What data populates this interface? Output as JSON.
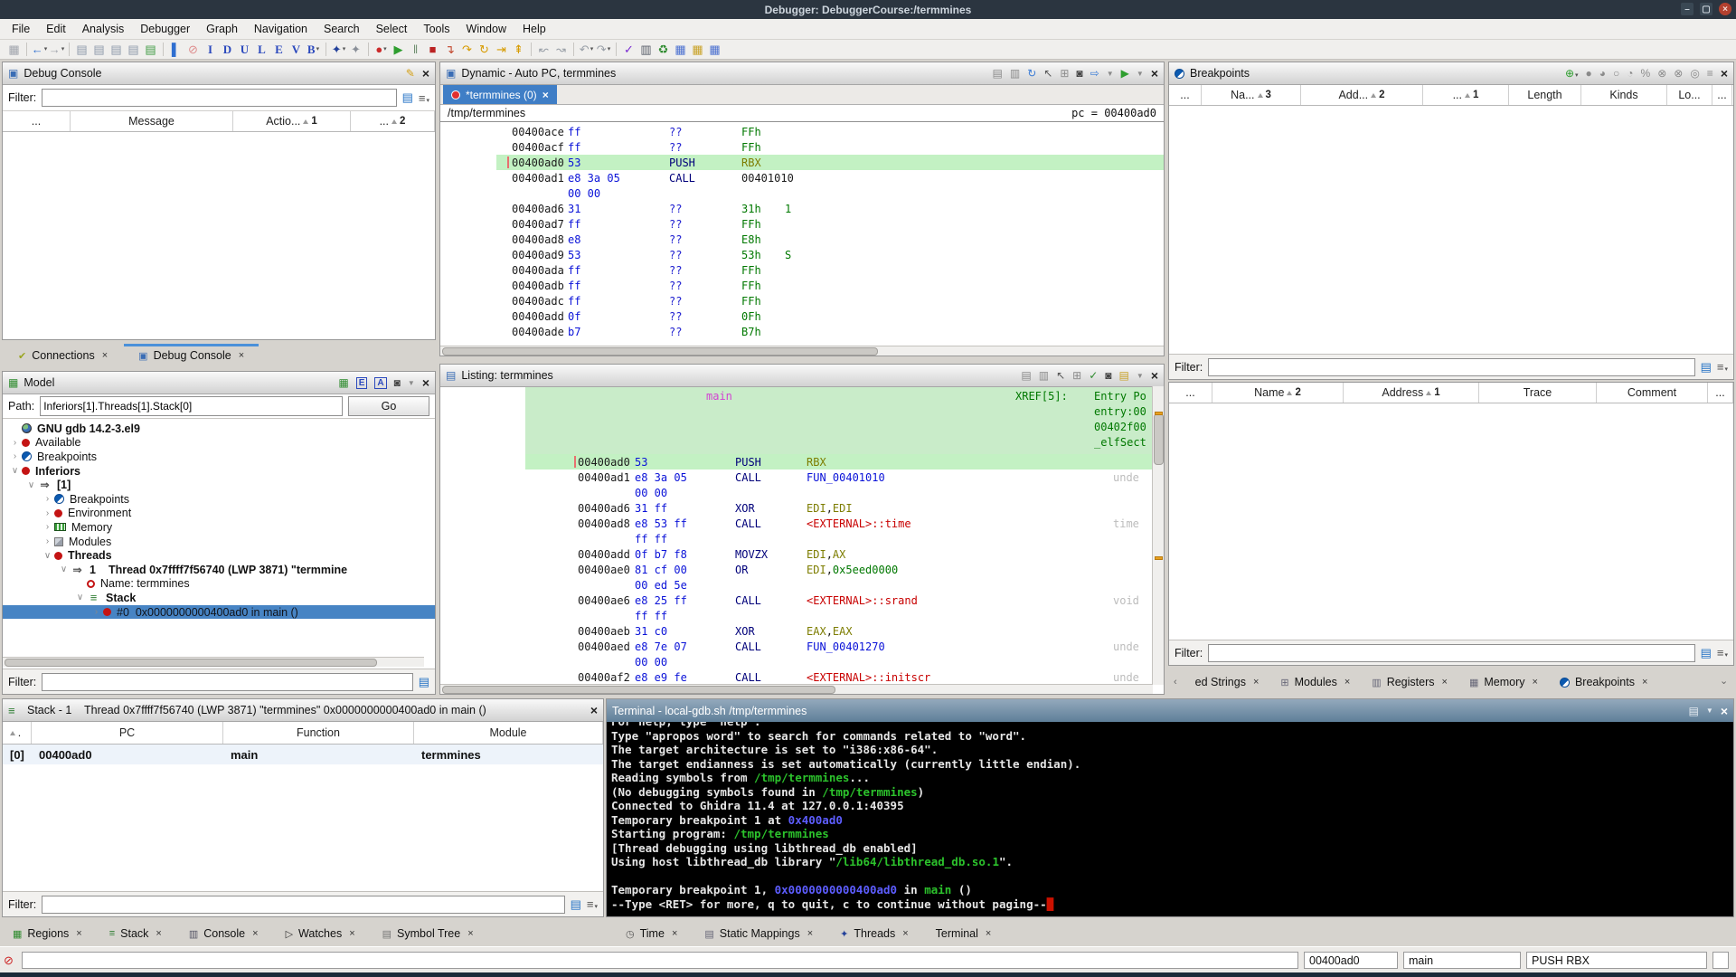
{
  "colors": {
    "accent_blue": "#3f7ec6",
    "pc_highlight_green": "#c3f1c3",
    "function_block_green": "#c9ecc9",
    "terminal_green": "#2cc22c",
    "terminal_blue": "#5d5dff",
    "terminal_cursor_red": "#cc1100",
    "titlebar_dark": "#2b3540"
  },
  "titlebar": {
    "title": "Debugger: DebuggerCourse:/termmines"
  },
  "menu": {
    "items": [
      "File",
      "Edit",
      "Analysis",
      "Debugger",
      "Graph",
      "Navigation",
      "Search",
      "Select",
      "Tools",
      "Window",
      "Help"
    ]
  },
  "toolbar": {
    "icons": [
      {
        "name": "save",
        "g": "▦",
        "c": "#a0a4ac"
      },
      {
        "sep": true
      },
      {
        "name": "nav-back",
        "g": "←",
        "c": "#2f6fd0",
        "v": true
      },
      {
        "name": "nav-forward",
        "g": "→",
        "c": "#a0a4ac",
        "v": true
      },
      {
        "sep": true
      },
      {
        "name": "copy-1",
        "g": "▤",
        "c": "#8d99aa"
      },
      {
        "name": "copy-2",
        "g": "▤",
        "c": "#8d99aa"
      },
      {
        "name": "copy-3",
        "g": "▤",
        "c": "#8d99aa"
      },
      {
        "name": "copy-4",
        "g": "▤",
        "c": "#8d99aa"
      },
      {
        "name": "copy-green",
        "g": "▤",
        "c": "#3f9b43"
      },
      {
        "sep": true
      },
      {
        "name": "cursor",
        "g": "▌",
        "c": "#2f6fd0"
      },
      {
        "name": "clear-highlight",
        "g": "⊘",
        "c": "#de8c8c"
      },
      {
        "name": "select-i",
        "g": "I",
        "c": "#2b49bd",
        "serif": true
      },
      {
        "name": "select-d",
        "g": "D",
        "c": "#2b49bd",
        "serif": true
      },
      {
        "name": "select-u",
        "g": "U",
        "c": "#2b49bd",
        "serif": true
      },
      {
        "name": "select-l",
        "g": "L",
        "c": "#2b49bd",
        "serif": true
      },
      {
        "name": "select-e",
        "g": "E",
        "c": "#2b49bd",
        "serif": true
      },
      {
        "name": "select-v",
        "g": "V",
        "c": "#2b49bd",
        "serif": true
      },
      {
        "name": "select-b",
        "g": "B",
        "c": "#2b49bd",
        "serif": true,
        "v": true
      },
      {
        "sep": true
      },
      {
        "name": "debug-target",
        "g": "✦",
        "c": "#23409a",
        "v": true
      },
      {
        "name": "debug-target-alt",
        "g": "✦",
        "c": "#8a8f98"
      },
      {
        "sep": true
      },
      {
        "name": "record",
        "g": "●",
        "c": "#cc2b2b",
        "v": true
      },
      {
        "name": "resume",
        "g": "▶",
        "c": "#2f9e2f"
      },
      {
        "name": "interrupt",
        "g": "‖",
        "c": "#6f8f6f"
      },
      {
        "name": "kill",
        "g": "■",
        "c": "#bb2222"
      },
      {
        "name": "step-into",
        "g": "↴",
        "c": "#c2452b"
      },
      {
        "name": "step-over",
        "g": "↷",
        "c": "#d79b00"
      },
      {
        "name": "step-out",
        "g": "↻",
        "c": "#d79b00"
      },
      {
        "name": "step-last",
        "g": "⇥",
        "c": "#d79b00"
      },
      {
        "name": "step-ext",
        "g": "⇞",
        "c": "#d79b00"
      },
      {
        "sep": true
      },
      {
        "name": "skip-over",
        "g": "↜",
        "c": "#9aa0a8"
      },
      {
        "name": "skip-out",
        "g": "↝",
        "c": "#9aa0a8"
      },
      {
        "sep": true
      },
      {
        "name": "undo",
        "g": "↶",
        "c": "#9aa0a8",
        "v": true
      },
      {
        "name": "redo",
        "g": "↷",
        "c": "#9aa0a8",
        "v": true
      },
      {
        "sep": true
      },
      {
        "name": "validate",
        "g": "✓",
        "c": "#7a2bd2"
      },
      {
        "name": "binary-view",
        "g": "▥",
        "c": "#555b66"
      },
      {
        "name": "recycle",
        "g": "♻",
        "c": "#2e8b2e"
      },
      {
        "name": "table-1",
        "g": "▦",
        "c": "#4a6fd0"
      },
      {
        "name": "table-2",
        "g": "▦",
        "c": "#c9a227"
      },
      {
        "name": "table-3",
        "g": "▦",
        "c": "#4a6fd0"
      }
    ]
  },
  "debug_console": {
    "title": "Debug Console",
    "filter_label": "Filter:",
    "filter_value": "",
    "columns": [
      {
        "label": "..."
      },
      {
        "label": "Message"
      },
      {
        "label": "Actio...",
        "sort": 1
      },
      {
        "label": "...",
        "sort": 2
      }
    ]
  },
  "left_tabs": [
    {
      "label": "Connections",
      "icon": "connections"
    },
    {
      "label": "Debug Console",
      "icon": "console",
      "selected": true
    }
  ],
  "model": {
    "title": "Model",
    "path_label": "Path:",
    "path_value": "Inferiors[1].Threads[1].Stack[0]",
    "go_label": "Go",
    "filter_label": "Filter:",
    "tree": [
      {
        "d": 0,
        "i": "bug",
        "l": "GNU gdb 14.2-3.el9",
        "b": true
      },
      {
        "d": 0,
        "a": "c",
        "i": "dot",
        "l": "Available"
      },
      {
        "d": 0,
        "a": "c",
        "i": "brk",
        "l": "Breakpoints"
      },
      {
        "d": 0,
        "a": "v",
        "i": "dot",
        "l": "Inferiors",
        "b": true
      },
      {
        "d": 1,
        "a": "v",
        "i": "arr",
        "l": "[1]",
        "b": true
      },
      {
        "d": 2,
        "a": "c",
        "i": "brk",
        "l": "Breakpoints"
      },
      {
        "d": 2,
        "a": "c",
        "i": "dot",
        "l": "Environment"
      },
      {
        "d": 2,
        "a": "c",
        "i": "mem",
        "l": "Memory"
      },
      {
        "d": 2,
        "a": "c",
        "i": "mod",
        "l": "Modules"
      },
      {
        "d": 2,
        "a": "v",
        "i": "dot",
        "l": "Threads",
        "b": true
      },
      {
        "d": 3,
        "a": "v",
        "i": "arr",
        "l": "1",
        "l2": "Thread 0x7ffff7f56740 (LWP 3871) \"termmine",
        "b": true
      },
      {
        "d": 4,
        "i": "ring",
        "l": "Name: termmines"
      },
      {
        "d": 4,
        "a": "v",
        "i": "stack",
        "l": "Stack",
        "b": true
      },
      {
        "d": 5,
        "a": "c",
        "i": "dot",
        "l": "#0  0x0000000000400ad0 in main ()",
        "sel": true
      }
    ]
  },
  "dynamic": {
    "title": "Dynamic - Auto PC, termmines",
    "tab": "*termmines (0)",
    "path": "/tmp/termmines",
    "pc_label": "pc = 00400ad0",
    "rows": [
      {
        "a": "00400ace",
        "b": "ff",
        "m": "??",
        "o": "FFh",
        "oc": "g"
      },
      {
        "a": "00400acf",
        "b": "ff",
        "m": "??",
        "o": "FFh",
        "oc": "g"
      },
      {
        "a": "00400ad0",
        "b": "53",
        "m": "PUSH",
        "o": "RBX",
        "oc": "o",
        "hl": true
      },
      {
        "a": "00400ad1",
        "b": "e8 3a 05",
        "m": "CALL",
        "o": "00401010",
        "oc": "d"
      },
      {
        "cont": "00 00"
      },
      {
        "a": "00400ad6",
        "b": "31",
        "m": "??",
        "o": "31h",
        "oc": "g",
        "x": "1"
      },
      {
        "a": "00400ad7",
        "b": "ff",
        "m": "??",
        "o": "FFh",
        "oc": "g"
      },
      {
        "a": "00400ad8",
        "b": "e8",
        "m": "??",
        "o": "E8h",
        "oc": "g"
      },
      {
        "a": "00400ad9",
        "b": "53",
        "m": "??",
        "o": "53h",
        "oc": "g",
        "x": "S"
      },
      {
        "a": "00400ada",
        "b": "ff",
        "m": "??",
        "o": "FFh",
        "oc": "g"
      },
      {
        "a": "00400adb",
        "b": "ff",
        "m": "??",
        "o": "FFh",
        "oc": "g"
      },
      {
        "a": "00400adc",
        "b": "ff",
        "m": "??",
        "o": "FFh",
        "oc": "g"
      },
      {
        "a": "00400add",
        "b": "0f",
        "m": "??",
        "o": "0Fh",
        "oc": "g"
      },
      {
        "a": "00400ade",
        "b": "b7",
        "m": "??",
        "o": "B7h",
        "oc": "g"
      }
    ]
  },
  "listing": {
    "title": "Listing: termmines",
    "function_name": "main",
    "xref_label": "XREF[5]:",
    "xref_lines": [
      "Entry Po",
      "entry:00",
      "00402f00",
      "_elfSect"
    ],
    "rows": [
      {
        "a": "00400ad0",
        "b": "53",
        "m": "PUSH",
        "op": [
          [
            "RBX",
            "o"
          ]
        ],
        "hl": true
      },
      {
        "a": "00400ad1",
        "b": "e8 3a 05",
        "m": "CALL",
        "op": [
          [
            "FUN_00401010",
            "bl"
          ]
        ],
        "note": "unde"
      },
      {
        "cont": "00 00"
      },
      {
        "a": "00400ad6",
        "b": "31 ff",
        "m": "XOR",
        "op": [
          [
            "EDI",
            "o"
          ],
          [
            ",",
            "d"
          ],
          [
            "EDI",
            "o"
          ]
        ]
      },
      {
        "a": "00400ad8",
        "b": "e8 53 ff",
        "m": "CALL",
        "op": [
          [
            "<EXTERNAL>::time",
            "r"
          ]
        ],
        "note": "time"
      },
      {
        "cont": "ff ff"
      },
      {
        "a": "00400add",
        "b": "0f b7 f8",
        "m": "MOVZX",
        "op": [
          [
            "EDI",
            "o"
          ],
          [
            ",",
            "d"
          ],
          [
            "AX",
            "o"
          ]
        ]
      },
      {
        "a": "00400ae0",
        "b": "81 cf 00",
        "m": "OR",
        "op": [
          [
            "EDI",
            "o"
          ],
          [
            ",",
            "d"
          ],
          [
            "0x5eed0000",
            "g"
          ]
        ]
      },
      {
        "cont": "00 ed 5e"
      },
      {
        "a": "00400ae6",
        "b": "e8 25 ff",
        "m": "CALL",
        "op": [
          [
            "<EXTERNAL>::srand",
            "r"
          ]
        ],
        "note": "void"
      },
      {
        "cont": "ff ff"
      },
      {
        "a": "00400aeb",
        "b": "31 c0",
        "m": "XOR",
        "op": [
          [
            "EAX",
            "o"
          ],
          [
            ",",
            "d"
          ],
          [
            "EAX",
            "o"
          ]
        ]
      },
      {
        "a": "00400aed",
        "b": "e8 7e 07",
        "m": "CALL",
        "op": [
          [
            "FUN_00401270",
            "bl"
          ]
        ],
        "note": "unde"
      },
      {
        "cont": "00 00"
      },
      {
        "a": "00400af2",
        "b": "e8 e9 fe",
        "m": "CALL",
        "op": [
          [
            "<EXTERNAL>::initscr",
            "r"
          ]
        ],
        "note": "unde"
      }
    ]
  },
  "breakpoints": {
    "title": "Breakpoints",
    "filter_label": "Filter:",
    "columns": [
      {
        "label": "..."
      },
      {
        "label": "Na...",
        "sort": 3
      },
      {
        "label": "Add...",
        "sort": 2
      },
      {
        "label": "...",
        "sort": 1
      },
      {
        "label": "Length"
      },
      {
        "label": "Kinds"
      },
      {
        "label": "Lo..."
      },
      {
        "label": "..."
      }
    ]
  },
  "right_table": {
    "filter_label": "Filter:",
    "columns": [
      {
        "label": "..."
      },
      {
        "label": "Name",
        "sort": 2
      },
      {
        "label": "Address",
        "sort": 1
      },
      {
        "label": "Trace"
      },
      {
        "label": "Comment"
      },
      {
        "label": "..."
      }
    ]
  },
  "right_tabs": [
    {
      "label": "ed Strings",
      "icon": null
    },
    {
      "label": "Modules",
      "icon": "modules"
    },
    {
      "label": "Registers",
      "icon": "registers"
    },
    {
      "label": "Memory",
      "icon": "memory"
    },
    {
      "label": "Breakpoints",
      "icon": "brk"
    }
  ],
  "stack": {
    "title": "Stack - 1    Thread 0x7ffff7f56740 (LWP 3871) \"termmines\" 0x0000000000400ad0 in main ()",
    "filter_label": "Filter:",
    "columns": [
      {
        "label": "",
        "sort_icon": true
      },
      {
        "label": "PC"
      },
      {
        "label": "Function"
      },
      {
        "label": "Module"
      }
    ],
    "rows": [
      [
        "[0]",
        "00400ad0",
        "main",
        "termmines"
      ]
    ]
  },
  "terminal": {
    "title": "Terminal - local-gdb.sh /tmp/termmines",
    "lines": [
      [
        [
          "For help, type \"help\".",
          "w"
        ]
      ],
      [
        [
          "Type \"apropos word\" to search for commands related to \"word\".",
          "w"
        ]
      ],
      [
        [
          "The target architecture is set to \"i386:x86-64\".",
          "w"
        ]
      ],
      [
        [
          "The target endianness is set automatically (currently little endian).",
          "w"
        ]
      ],
      [
        [
          "Reading symbols from ",
          "w"
        ],
        [
          "/tmp/termmines",
          "g"
        ],
        [
          "...",
          "w"
        ]
      ],
      [
        [
          "(No debugging symbols found in ",
          "w"
        ],
        [
          "/tmp/termmines",
          "g"
        ],
        [
          ")",
          "w"
        ]
      ],
      [
        [
          "Connected to Ghidra 11.4 at 127.0.0.1:40395",
          "w"
        ]
      ],
      [
        [
          "Temporary breakpoint 1 at ",
          "w"
        ],
        [
          "0x400ad0",
          "b"
        ]
      ],
      [
        [
          "Starting program: ",
          "w"
        ],
        [
          "/tmp/termmines",
          "g"
        ]
      ],
      [
        [
          "[Thread debugging using libthread_db enabled]",
          "w"
        ]
      ],
      [
        [
          "Using host libthread_db library \"",
          "w"
        ],
        [
          "/lib64/libthread_db.so.1",
          "g"
        ],
        [
          "\".",
          "w"
        ]
      ],
      [],
      [
        [
          "Temporary breakpoint 1, ",
          "w"
        ],
        [
          "0x0000000000400ad0",
          "b"
        ],
        [
          " in ",
          "w"
        ],
        [
          "main",
          "g"
        ],
        [
          " ()",
          "w"
        ]
      ],
      [
        [
          "--Type <RET> for more, q to quit, c to continue without paging--",
          "w"
        ],
        [
          "█",
          "cur"
        ]
      ]
    ]
  },
  "bottom_left_tabs": [
    {
      "label": "Regions",
      "icon": "regions"
    },
    {
      "label": "Stack",
      "icon": "stackt"
    },
    {
      "label": "Console",
      "icon": "consolewin"
    },
    {
      "label": "Watches",
      "icon": "watches"
    },
    {
      "label": "Symbol Tree",
      "icon": "symtree"
    }
  ],
  "bottom_mid_tabs": [
    {
      "label": "Time",
      "icon": "time"
    },
    {
      "label": "Static Mappings",
      "icon": "mappings"
    },
    {
      "label": "Threads",
      "icon": "threads"
    },
    {
      "label": "Terminal",
      "icon": null
    }
  ],
  "status": {
    "fields": [
      "00400ad0",
      "main",
      "PUSH RBX"
    ]
  }
}
